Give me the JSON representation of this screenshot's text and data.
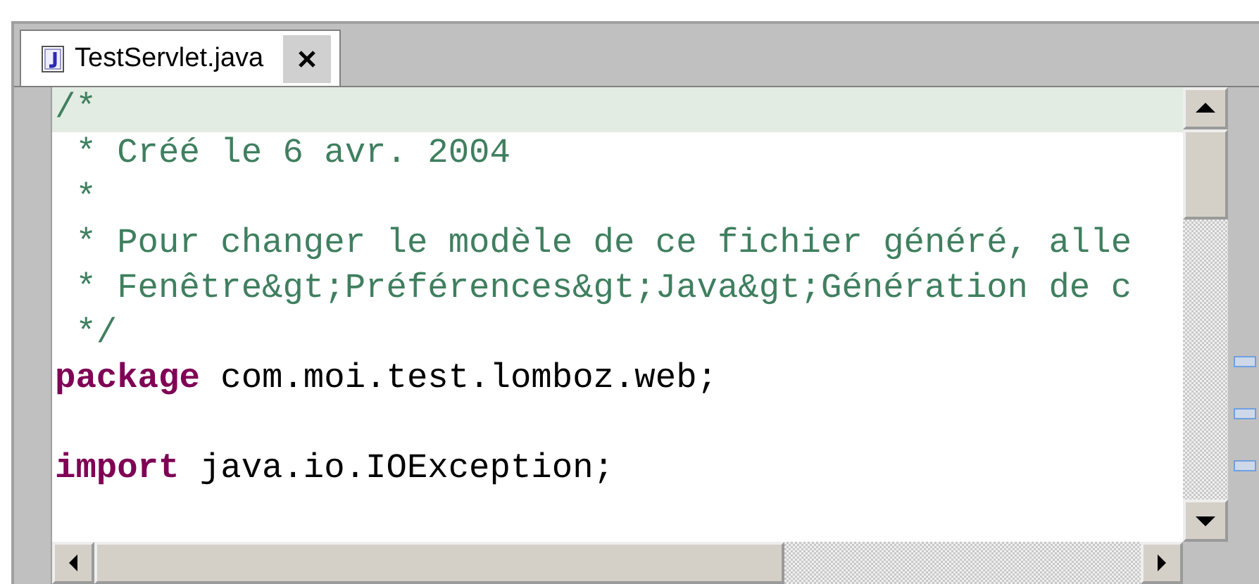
{
  "tabs": [
    {
      "label": "TestServlet.java",
      "selected": true,
      "closable": true
    }
  ],
  "editor": {
    "lines": [
      {
        "current": true,
        "segments": [
          {
            "kind": "comment",
            "text": "/*"
          }
        ]
      },
      {
        "current": false,
        "segments": [
          {
            "kind": "comment",
            "text": " * Créé le 6 avr. 2004"
          }
        ]
      },
      {
        "current": false,
        "segments": [
          {
            "kind": "comment",
            "text": " *"
          }
        ]
      },
      {
        "current": false,
        "segments": [
          {
            "kind": "comment",
            "text": " * Pour changer le modèle de ce fichier généré, alle"
          }
        ]
      },
      {
        "current": false,
        "segments": [
          {
            "kind": "comment",
            "text": " * Fenêtre&gt;Préférences&gt;Java&gt;Génération de c"
          }
        ]
      },
      {
        "current": false,
        "segments": [
          {
            "kind": "comment",
            "text": " */"
          }
        ]
      },
      {
        "current": false,
        "segments": [
          {
            "kind": "keyword",
            "text": "package"
          },
          {
            "kind": "plain",
            "text": " com.moi.test.lomboz.web;"
          }
        ]
      },
      {
        "current": false
      },
      {
        "current": false,
        "segments": [
          {
            "kind": "keyword",
            "text": "import"
          },
          {
            "kind": "plain",
            "text": " java.io.IOException;"
          }
        ]
      },
      {
        "current": false
      }
    ]
  }
}
